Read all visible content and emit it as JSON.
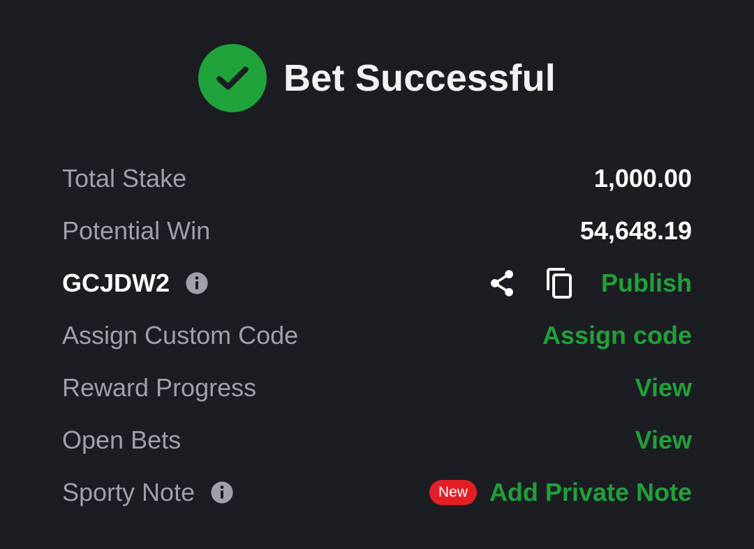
{
  "header": {
    "title": "Bet Successful",
    "icon": "check-circle-icon"
  },
  "colors": {
    "background": "#1c1d23",
    "accent_green": "#21a038",
    "label_gray": "#9fa1a8",
    "badge_red": "#e41e26"
  },
  "rows": {
    "total_stake": {
      "label": "Total Stake",
      "value": "1,000.00"
    },
    "potential_win": {
      "label": "Potential Win",
      "value": "54,648.19"
    },
    "booking_code": {
      "code": "GCJDW2",
      "publish_label": "Publish"
    },
    "custom_code": {
      "label": "Assign Custom Code",
      "action": "Assign code"
    },
    "reward_progress": {
      "label": "Reward Progress",
      "action": "View"
    },
    "open_bets": {
      "label": "Open Bets",
      "action": "View"
    },
    "sporty_note": {
      "label": "Sporty Note",
      "badge": "New",
      "action": "Add Private Note"
    }
  }
}
